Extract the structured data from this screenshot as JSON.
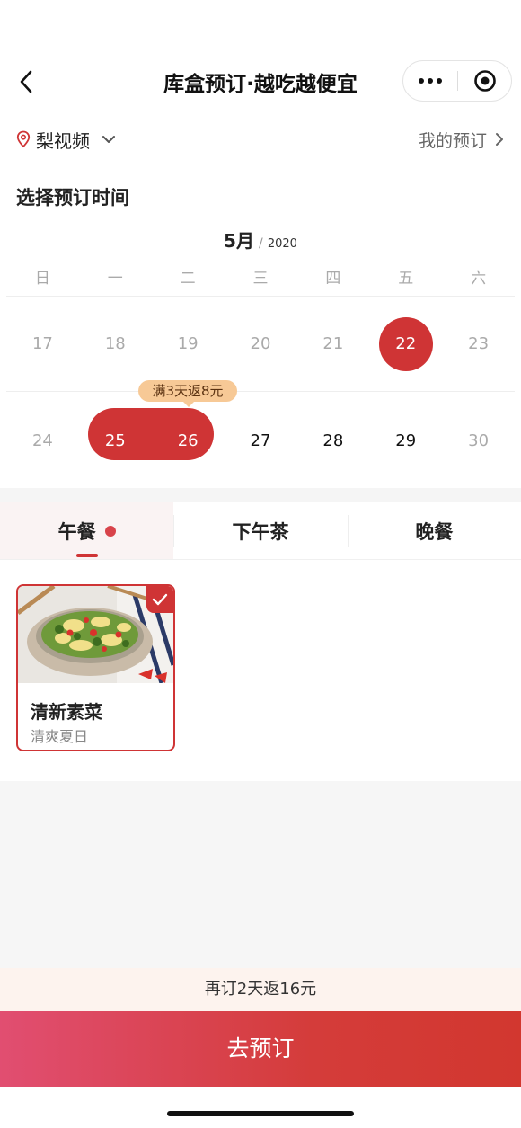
{
  "nav": {
    "title": "库盒预订·越吃越便宜"
  },
  "location": {
    "name": "梨视频",
    "my_orders_label": "我的预订"
  },
  "calendar": {
    "section_title": "选择预订时间",
    "month_label": "5月",
    "month_separator": "/",
    "year_label": "2020",
    "weekdays": [
      "日",
      "一",
      "二",
      "三",
      "四",
      "五",
      "六"
    ],
    "week1": [
      "17",
      "18",
      "19",
      "20",
      "21",
      "22",
      "23"
    ],
    "week2": [
      "24",
      "25",
      "26",
      "27",
      "28",
      "29",
      "30"
    ],
    "selected_dates": [
      "22",
      "25",
      "26"
    ],
    "promo_tip": "满3天返8元"
  },
  "meal_tabs": {
    "lunch": "午餐",
    "afternoon_tea": "下午茶",
    "dinner": "晚餐"
  },
  "menu": {
    "items": [
      {
        "name": "清新素菜",
        "subtitle": "清爽夏日",
        "selected": true
      }
    ]
  },
  "footer": {
    "promo_text": "再订2天返16元",
    "book_button": "去预订"
  },
  "colors": {
    "accent": "#cf3435",
    "tip_bg": "#f7c996",
    "promo_bg": "#fdf3ee"
  }
}
